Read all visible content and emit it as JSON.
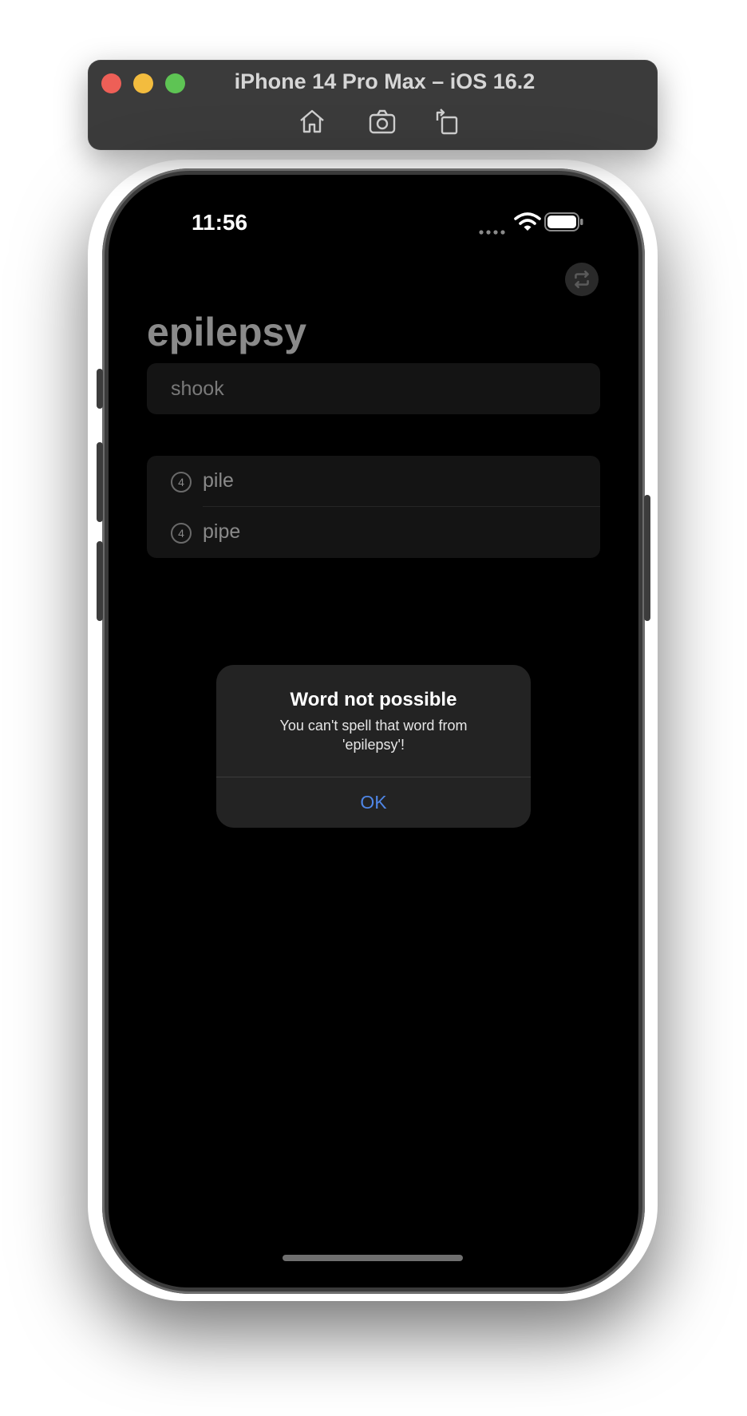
{
  "simulator": {
    "title": "iPhone 14 Pro Max – iOS 16.2",
    "icons": [
      "home-icon",
      "screenshot-icon",
      "rotate-icon"
    ]
  },
  "status_bar": {
    "time": "11:56"
  },
  "app": {
    "root_word": "epilepsy",
    "entry_value": "shook",
    "used_words": [
      {
        "count": "4",
        "word": "pile"
      },
      {
        "count": "4",
        "word": "pipe"
      }
    ]
  },
  "alert": {
    "title": "Word not possible",
    "message": "You can't spell that word from 'epilepsy'!",
    "ok_label": "OK",
    "ok_color": "#4f86e6"
  }
}
